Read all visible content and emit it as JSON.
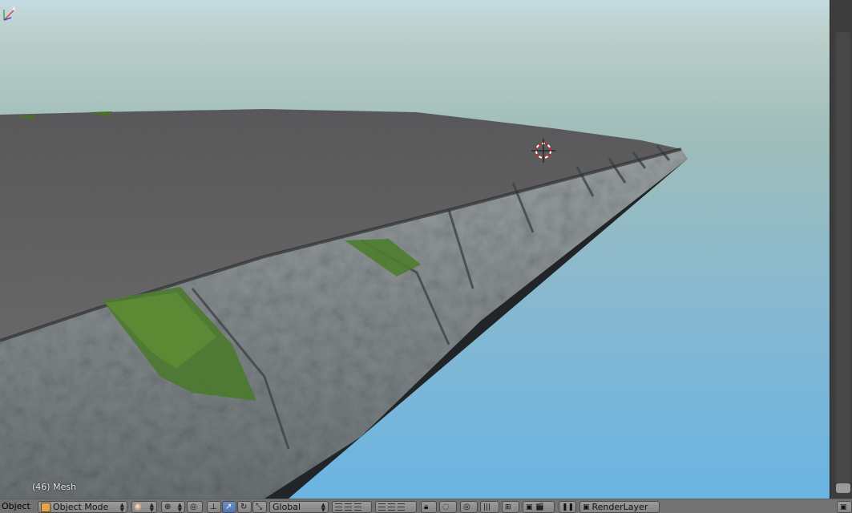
{
  "viewport": {
    "info_text": "(46) Mesh"
  },
  "header": {
    "editor_type_label": "Object",
    "mode_label": "Object Mode",
    "orientation_label": "Global",
    "render_layer_label": "RenderLayer"
  },
  "icons": [
    "cube-icon",
    "sphere-shading-icon",
    "pivot-icon",
    "proportional-icon",
    "translate-manipulator-icon",
    "rotate-manipulator-icon",
    "scale-manipulator-icon",
    "layers-grid-icon",
    "lock-icon",
    "snap-icon",
    "render-icon",
    "camera-icon",
    "pause-icon",
    "render-layer-icon"
  ],
  "colors": {
    "header_bg": "#727272",
    "active_button": "#5177b3",
    "sky_top": "#c5dbe3",
    "sky_bottom": "#6ab4e2"
  }
}
